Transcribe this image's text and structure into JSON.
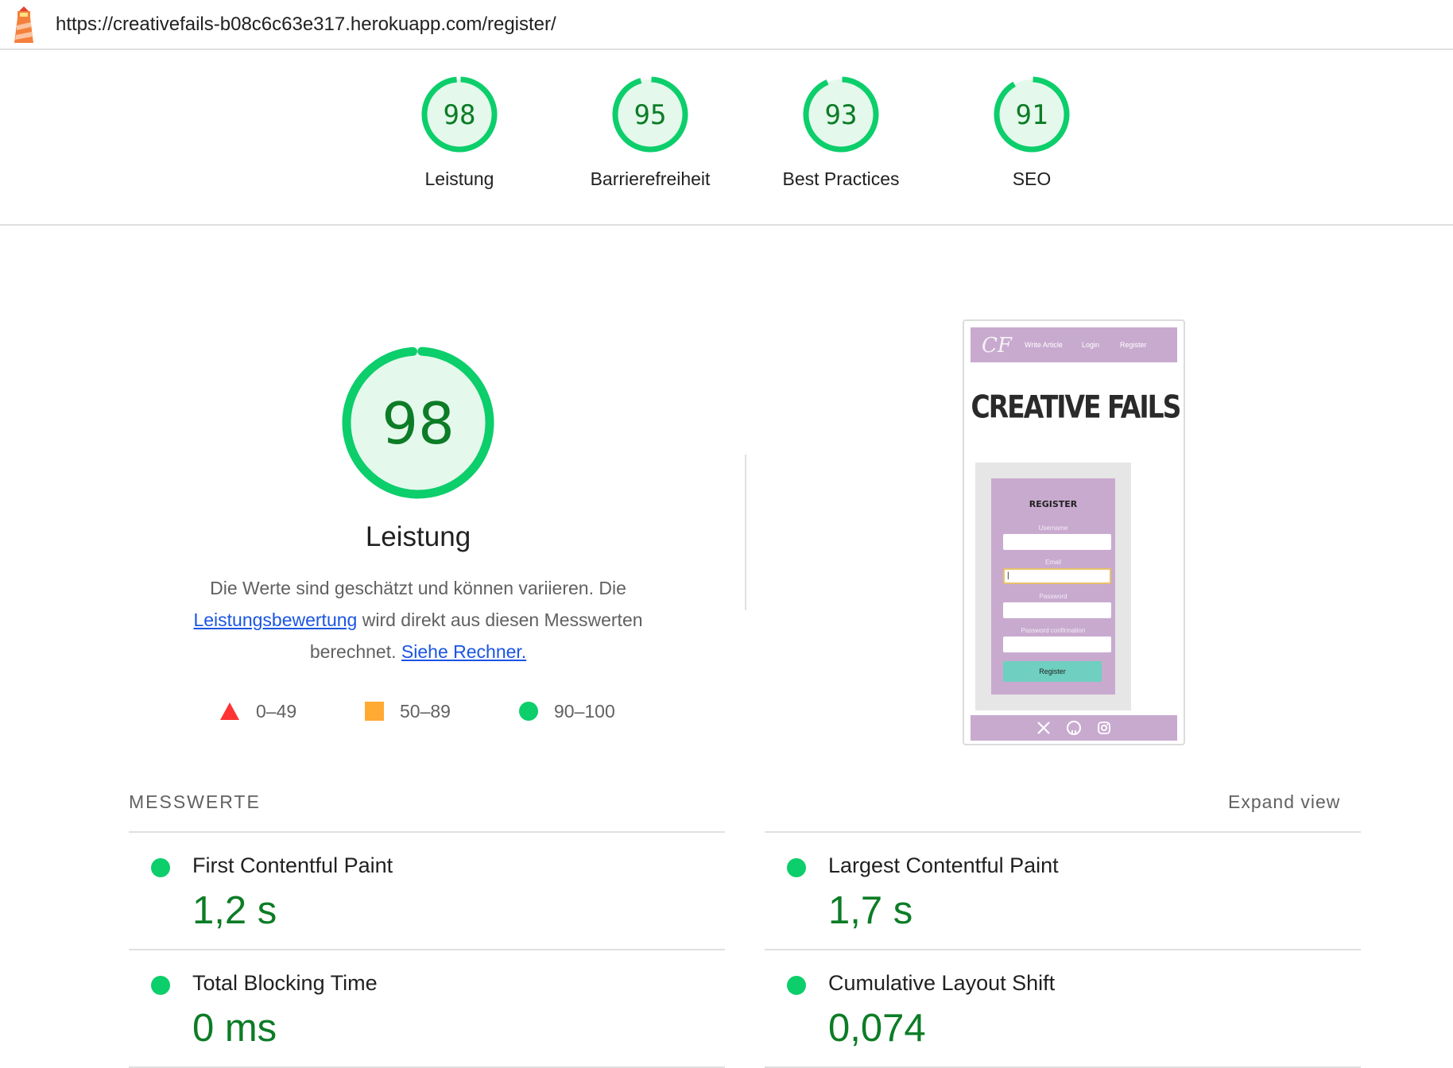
{
  "url_bar": {
    "url": "https://creativefails-b08c6c63e317.herokuapp.com/register/",
    "logo_icon": "lighthouse-icon"
  },
  "categories": [
    {
      "score": "98",
      "label": "Leistung"
    },
    {
      "score": "95",
      "label": "Barrierefreiheit"
    },
    {
      "score": "93",
      "label": "Best Practices"
    },
    {
      "score": "91",
      "label": "SEO"
    }
  ],
  "performance": {
    "score": "98",
    "title": "Leistung",
    "desc_part1": "Die Werte sind geschätzt und können variieren. Die",
    "desc_link1": "Leistungsbewertung",
    "desc_part2": "wird direkt aus diesen Messwerten berechnet.",
    "desc_link2": "Siehe Rechner.",
    "legend": [
      {
        "range": "0–49",
        "shape": "triangle",
        "color": "#ff3333"
      },
      {
        "range": "50–89",
        "shape": "square",
        "color": "#ffaa33"
      },
      {
        "range": "90–100",
        "shape": "circle",
        "color": "#0cce6b"
      }
    ]
  },
  "thumbnail": {
    "logo": "CF",
    "nav_links": [
      "Write Article",
      "Login",
      "Register"
    ],
    "hero": "CREATIVE FAILS",
    "form_title": "REGISTER",
    "fields": [
      "Username",
      "Email",
      "Password",
      "Password confirmation"
    ],
    "email_value": "|",
    "button": "Register",
    "footer_icons": [
      "x-icon",
      "github-icon",
      "instagram-icon"
    ]
  },
  "metrics": {
    "section_title": "MESSWERTE",
    "expand_label": "Expand view",
    "items": [
      {
        "name": "First Contentful Paint",
        "value": "1,2 s",
        "status": "good"
      },
      {
        "name": "Largest Contentful Paint",
        "value": "1,7 s",
        "status": "good"
      },
      {
        "name": "Total Blocking Time",
        "value": "0 ms",
        "status": "good"
      },
      {
        "name": "Cumulative Layout Shift",
        "value": "0,074",
        "status": "good"
      }
    ]
  },
  "colors": {
    "pass_green": "#0cce6b",
    "pass_text": "#0c7c26",
    "pass_fill": "#e5f8ec",
    "link_blue": "#1a55e3",
    "thumb_purple": "#c8aacf",
    "thumb_button": "#6fcfc0"
  }
}
